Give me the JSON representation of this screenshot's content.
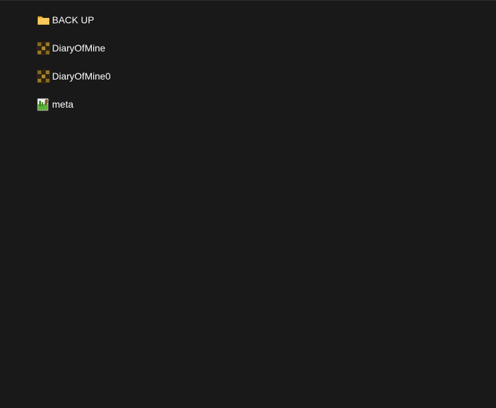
{
  "explorer": {
    "items": [
      {
        "name": "BACK UP",
        "icon": "folder-icon"
      },
      {
        "name": "DiaryOfMine",
        "icon": "minecraft-world-icon"
      },
      {
        "name": "DiaryOfMine0",
        "icon": "minecraft-world-icon"
      },
      {
        "name": "meta",
        "icon": "text-file-icon"
      }
    ]
  },
  "colors": {
    "background": "#191919",
    "text": "#ffffff",
    "folder": "#f5c04a"
  }
}
